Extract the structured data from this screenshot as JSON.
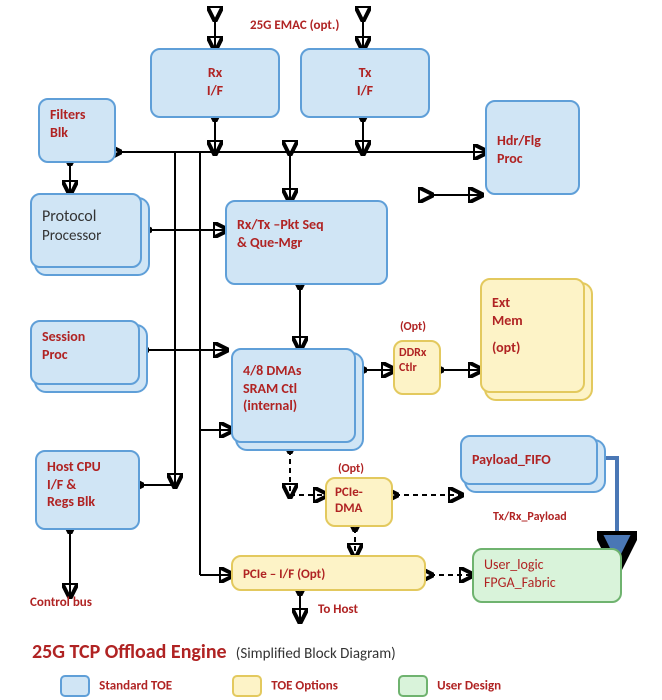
{
  "header": {
    "emac": "25G EMAC (opt.)"
  },
  "blocks": {
    "rx_if_l1": "Rx",
    "rx_if_l2": "I/F",
    "tx_if_l1": "Tx",
    "tx_if_l2": "I/F",
    "filters_l1": "Filters",
    "filters_l2": "Blk",
    "hdrflg_l1": "Hdr/Flg",
    "hdrflg_l2": "Proc",
    "proto_l1": "Protocol",
    "proto_l2": "Processor",
    "pktseq_l1": "Rx/Tx –Pkt Seq",
    "pktseq_l2": "&     Que-Mgr",
    "session_l1": "Session",
    "session_l2": "Proc",
    "dma_l1": "4/8 DMAs",
    "dma_l2": "SRAM Ctl",
    "dma_l3": "(internal)",
    "host_l1": "Host CPU",
    "host_l2": "I/F  &",
    "host_l3": "Regs Blk",
    "payload_fifo": "Payload_FIFO",
    "pcie_dma_l1": "PCIe-",
    "pcie_dma_l2": "DMA",
    "pcie_if": "PCIe – I/F      (Opt)",
    "ddrx_l1": "DDRx",
    "ddrx_l2": "Ctlr",
    "extmem_l1": "Ext",
    "extmem_l2": "Mem",
    "extmem_l3": "(opt)",
    "userlogic_l1": "User_logic",
    "userlogic_l2": "FPGA_Fabric"
  },
  "labels": {
    "opt1": "(Opt)",
    "opt2": "(Opt)",
    "txrx_payload": "Tx/Rx_Payload",
    "to_host": "To Host",
    "control_bus": "Control bus"
  },
  "title": {
    "main": "25G TCP Offload Engine",
    "sub": "(Simplified Block Diagram)"
  },
  "legend": {
    "standard": "Standard TOE",
    "options": "TOE Options",
    "user": "User Design"
  }
}
